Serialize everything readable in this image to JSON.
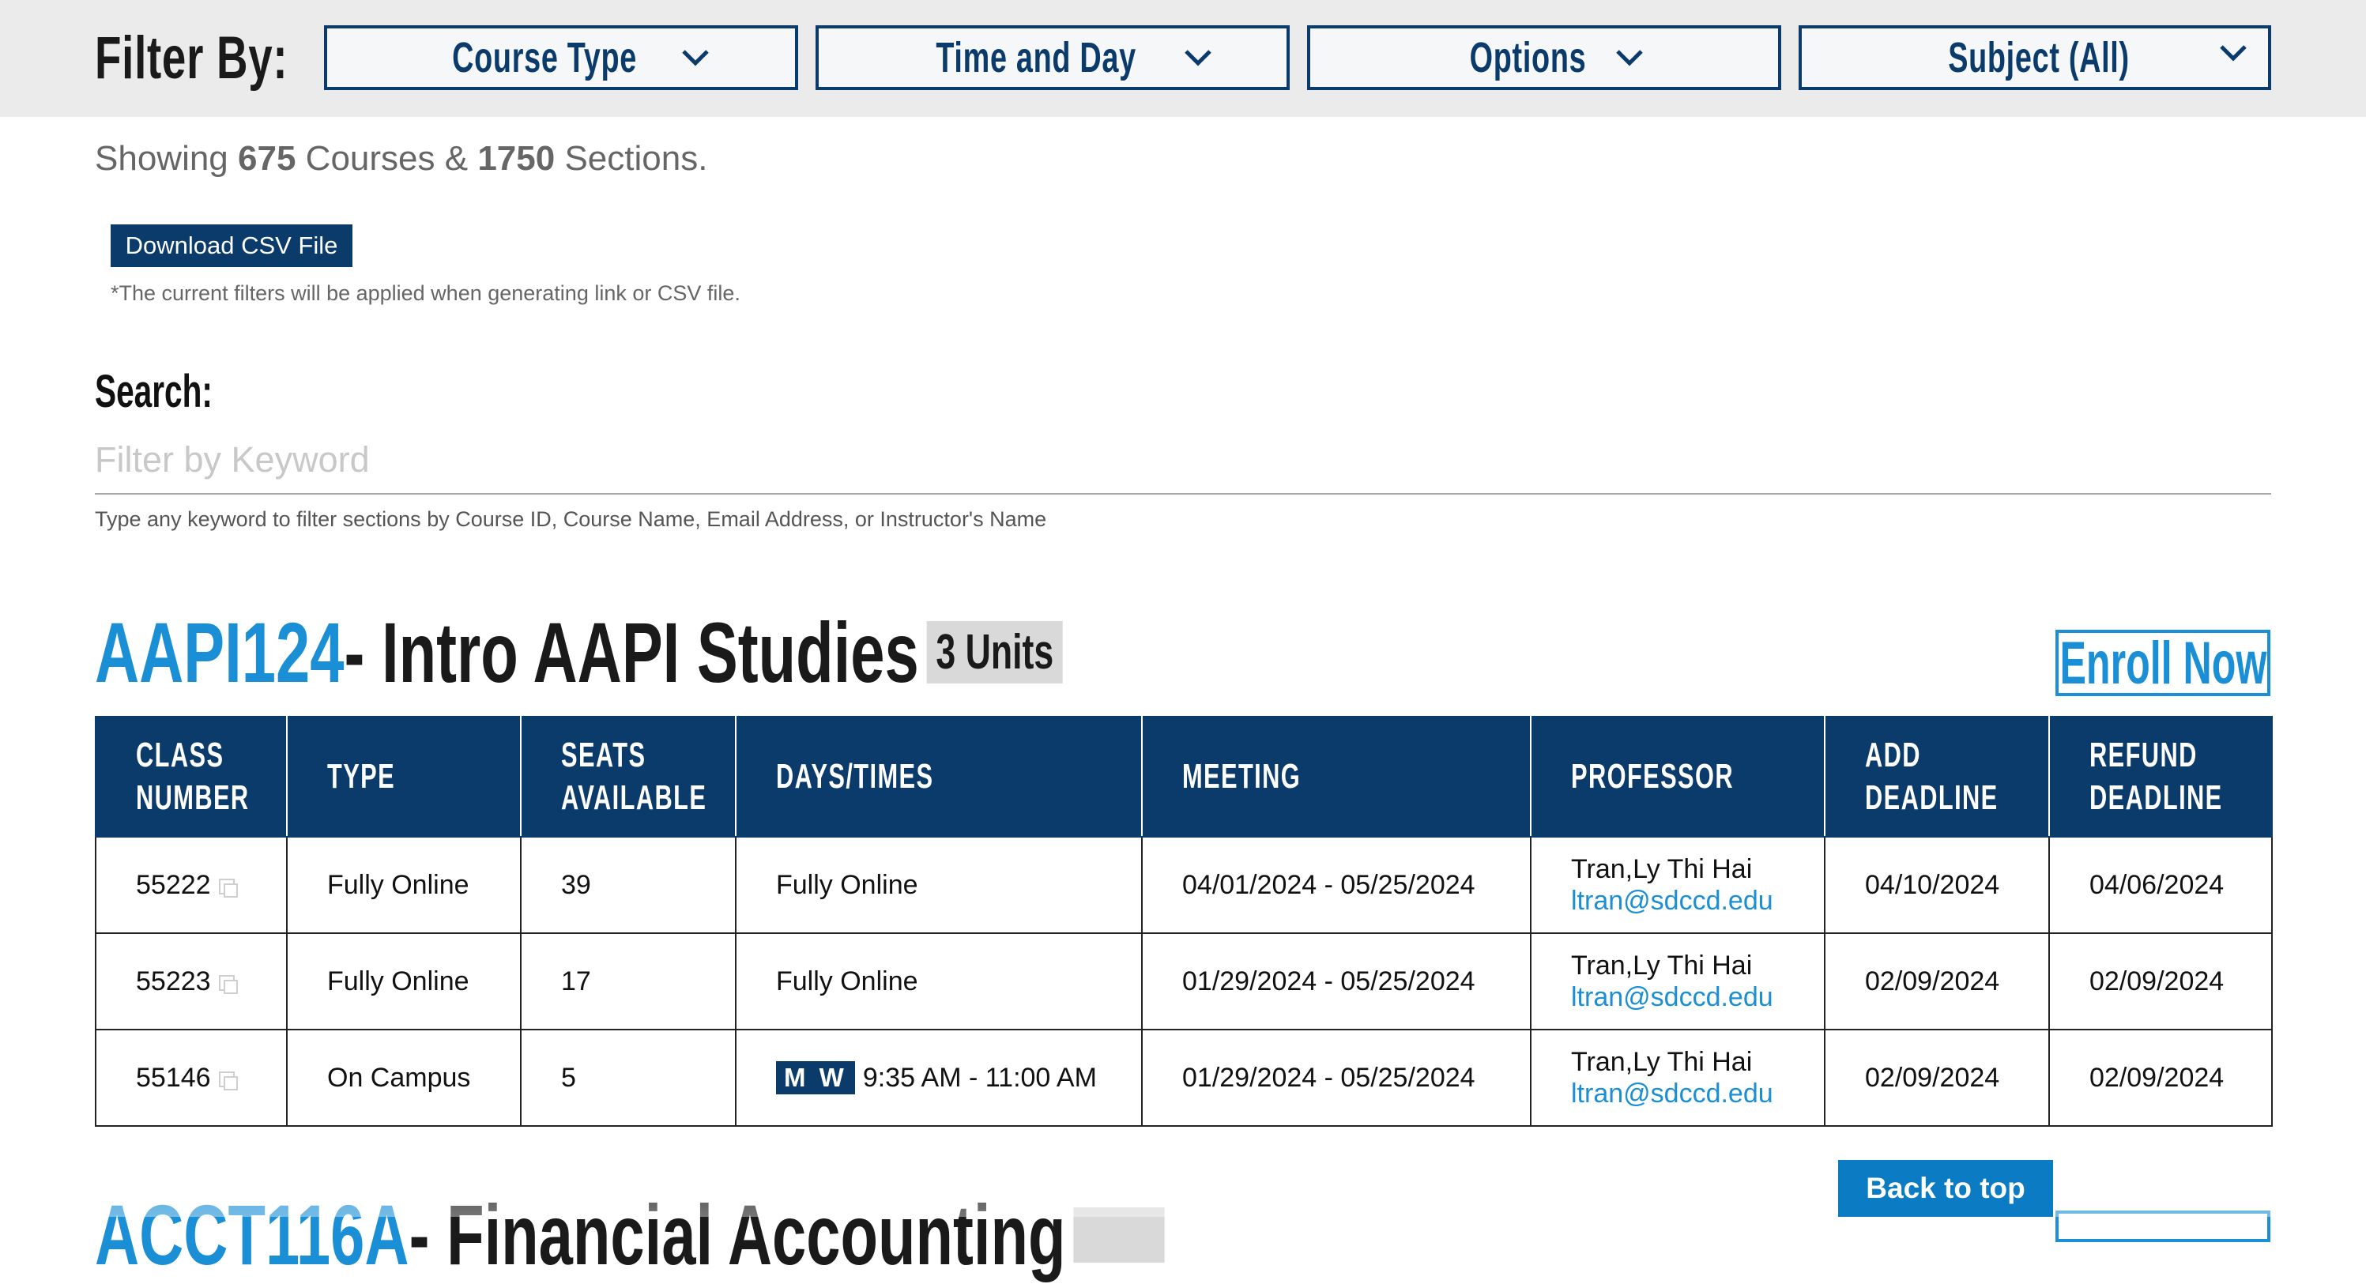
{
  "filter_bar": {
    "label": "Filter By:",
    "buttons": [
      {
        "label": "Course Type",
        "icon": "chevron-down-icon"
      },
      {
        "label": "Time and Day",
        "icon": "chevron-down-icon"
      },
      {
        "label": "Options",
        "icon": "chevron-down-icon"
      },
      {
        "label": "Subject (All)",
        "icon": "chevron-down-icon"
      }
    ]
  },
  "summary": {
    "prefix": "Showing",
    "courses_count": "675",
    "mid": "Courses &",
    "sections_count": "1750",
    "suffix": "Sections."
  },
  "csv": {
    "button_label": "Download CSV File",
    "note": "*The current filters will be applied when generating link or CSV file."
  },
  "search": {
    "label": "Search:",
    "placeholder": "Filter by Keyword",
    "value": "",
    "help": "Type any keyword to filter sections by Course ID, Course Name, Email Address, or Instructor's Name"
  },
  "course": {
    "id": "AAPI124",
    "name": "- Intro AAPI Studies",
    "units": "3 Units",
    "enroll_label": "Enroll Now",
    "columns": [
      {
        "line1": "CLASS",
        "line2": "NUMBER"
      },
      {
        "line1": "TYPE",
        "line2": ""
      },
      {
        "line1": "SEATS",
        "line2": "AVAILABLE"
      },
      {
        "line1": "DAYS/TIMES",
        "line2": ""
      },
      {
        "line1": "MEETING",
        "line2": ""
      },
      {
        "line1": "PROFESSOR",
        "line2": ""
      },
      {
        "line1": "ADD",
        "line2": "DEADLINE"
      },
      {
        "line1": "REFUND",
        "line2": "DEADLINE"
      }
    ],
    "rows": [
      {
        "class_number": "55222",
        "type": "Fully Online",
        "seats": "39",
        "days": "",
        "times": "Fully Online",
        "meeting": "04/01/2024 - 05/25/2024",
        "prof_name": "Tran,Ly Thi Hai",
        "prof_email": "ltran@sdccd.edu",
        "add_deadline": "04/10/2024",
        "refund_deadline": "04/06/2024"
      },
      {
        "class_number": "55223",
        "type": "Fully Online",
        "seats": "17",
        "days": "",
        "times": "Fully Online",
        "meeting": "01/29/2024 - 05/25/2024",
        "prof_name": "Tran,Ly Thi Hai",
        "prof_email": "ltran@sdccd.edu",
        "add_deadline": "02/09/2024",
        "refund_deadline": "02/09/2024"
      },
      {
        "class_number": "55146",
        "type": "On Campus",
        "seats": "5",
        "days": "M W",
        "times": "9:35 AM - 11:00 AM",
        "meeting": "01/29/2024 - 05/25/2024",
        "prof_name": "Tran,Ly Thi Hai",
        "prof_email": "ltran@sdccd.edu",
        "add_deadline": "02/09/2024",
        "refund_deadline": "02/09/2024"
      }
    ]
  },
  "next_course": {
    "id": "ACCT116A",
    "name": "- Financial Accounting"
  },
  "back_to_top": "Back to top",
  "colors": {
    "navy": "#0b3b6b",
    "accent_blue": "#1a8fd6",
    "filter_bar_bg": "#ebebeb",
    "back_to_top_bg": "#0b7bc4"
  }
}
